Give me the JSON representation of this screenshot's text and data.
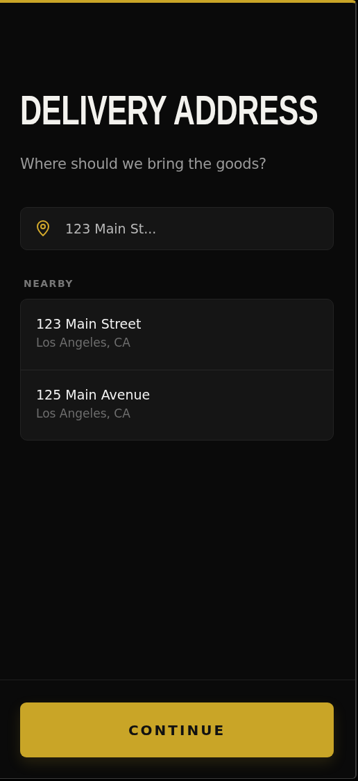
{
  "title": "DELIVERY ADDRESS",
  "subtitle": "Where should we bring the goods?",
  "address_field": {
    "value": "123 Main St..."
  },
  "nearby": {
    "label": "NEARBY",
    "items": [
      {
        "street": "123 Main Street",
        "city": "Los Angeles, CA"
      },
      {
        "street": "125 Main Avenue",
        "city": "Los Angeles, CA"
      }
    ]
  },
  "button": "CONTINUE"
}
